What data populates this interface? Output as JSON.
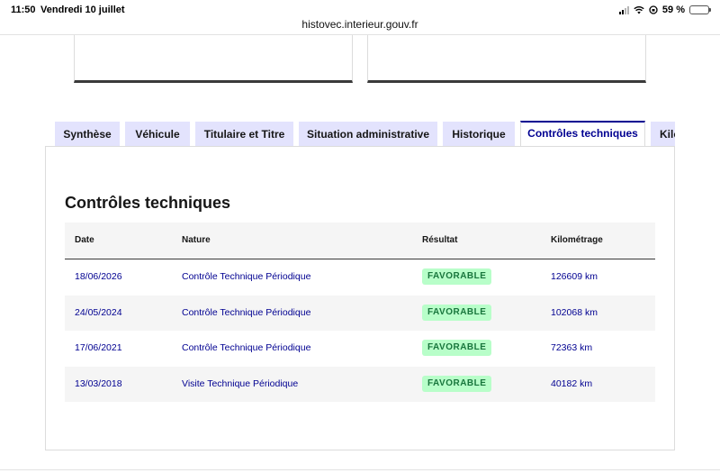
{
  "status_bar": {
    "time": "11:50",
    "date": "Vendredi 10 juillet",
    "battery": "59 %",
    "battery_level": 0.59
  },
  "browser": {
    "url": "histovec.interieur.gouv.fr"
  },
  "tabs": [
    {
      "label": "Synthèse",
      "active": false
    },
    {
      "label": "Véhicule",
      "active": false
    },
    {
      "label": "Titulaire et Titre",
      "active": false
    },
    {
      "label": "Situation administrative",
      "active": false
    },
    {
      "label": "Historique",
      "active": false
    },
    {
      "label": "Contrôles techniques",
      "active": true
    },
    {
      "label": "Kilo",
      "active": false
    }
  ],
  "section": {
    "title": "Contrôles techniques"
  },
  "table": {
    "headers": [
      "Date",
      "Nature",
      "Résultat",
      "Kilométrage"
    ],
    "rows": [
      {
        "date": "18/06/2026",
        "nature": "Contrôle Technique Périodique",
        "result": "FAVORABLE",
        "km": "126609 km"
      },
      {
        "date": "24/05/2024",
        "nature": "Contrôle Technique Périodique",
        "result": "FAVORABLE",
        "km": "102068 km"
      },
      {
        "date": "17/06/2021",
        "nature": "Contrôle Technique Périodique",
        "result": "FAVORABLE",
        "km": "72363 km"
      },
      {
        "date": "13/03/2018",
        "nature": "Visite Technique Périodique",
        "result": "FAVORABLE",
        "km": "40182 km"
      }
    ]
  },
  "colors": {
    "accent": "#000091",
    "tab_bg": "#e3e3fd",
    "badge_bg": "#b8fec9",
    "badge_text": "#18753c"
  }
}
